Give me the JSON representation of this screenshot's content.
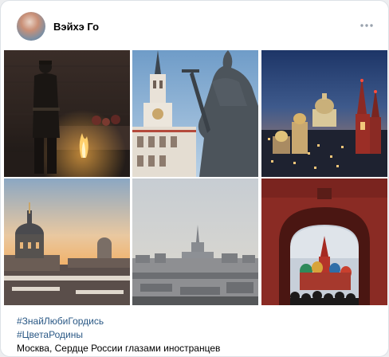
{
  "post": {
    "author_name": "Вэйхэ Го",
    "avatar_icon": "avatar-image",
    "more_icon": "more-horizontal-icon",
    "hashtags": [
      "#ЗнайЛюбиГордись",
      "#ЦветаРодины"
    ],
    "caption": "Москва, Сердце России глазами иностранцев",
    "photo_count": 6,
    "colors": {
      "link": "#2a5885",
      "text": "#000000",
      "card_background": "#ffffff",
      "page_background": "#edeef0",
      "more_icon": "#99a2ad"
    }
  }
}
